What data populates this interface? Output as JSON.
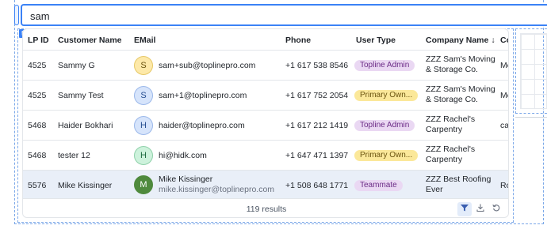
{
  "search": {
    "value": "sam"
  },
  "component_tag": "textSearch",
  "table": {
    "headers": [
      "LP ID",
      "Customer Name",
      "EMail",
      "Phone",
      "User Type",
      "Company Name",
      "Co"
    ],
    "sort_indicator": "↓",
    "rows": [
      {
        "id": "4525",
        "name": "Sammy G",
        "avatar": "S",
        "email": "sam+sub@toplinepro.com",
        "phone": "+1 617 538 8546",
        "type": "Topline Admin",
        "company": "ZZZ Sam's Moving & Storage Co.",
        "co": "Mo"
      },
      {
        "id": "4525",
        "name": "Sammy Test",
        "avatar": "S",
        "email": "sam+1@toplinepro.com",
        "phone": "+1 617 752 2054",
        "type": "Primary Own...",
        "company": "ZZZ Sam's Moving & Storage Co.",
        "co": "Mo"
      },
      {
        "id": "5468",
        "name": "Haider Bokhari",
        "avatar": "H",
        "email": "haider@toplinepro.com",
        "phone": "+1 617 212 1419",
        "type": "Topline Admin",
        "company": "ZZZ Rachel's Carpentry",
        "co": "car"
      },
      {
        "id": "5468",
        "name": "tester 12",
        "avatar": "H",
        "email": "hi@hidk.com",
        "phone": "+1 647 471 1397",
        "type": "Primary Own...",
        "company": "ZZZ Rachel's Carpentry",
        "co": "car"
      },
      {
        "id": "5576",
        "name": "Mike Kissinger",
        "avatar": "M",
        "email_name": "Mike Kissinger",
        "email": "mike.kissinger@toplinepro.com",
        "phone": "+1 508 648 1771",
        "type": "Teammate",
        "company": "ZZZ Best Roofing Ever",
        "co": "Ro"
      }
    ]
  },
  "footer": {
    "results": "119 results"
  },
  "icons": {
    "filter": "filter-icon",
    "download": "download-icon",
    "reset": "reset-icon"
  },
  "colors": {
    "accent": "#3b82f6",
    "topline_admin_pill": "#ead8f3",
    "primary_owner_pill": "#fbe89a",
    "teammate_pill": "#ead8f3",
    "avatar_yellow": "#fde9a9",
    "avatar_blue": "#d6e4fb",
    "avatar_green": "#cdf2dc",
    "avatar_dark_green": "#4f8a3d"
  }
}
